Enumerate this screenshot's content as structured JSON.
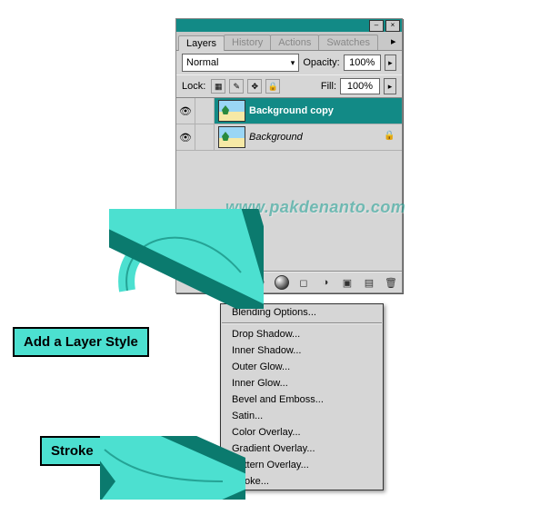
{
  "tabs": {
    "layers": "Layers",
    "history": "History",
    "actions": "Actions",
    "swatches": "Swatches"
  },
  "blend_row": {
    "mode": "Normal",
    "opacity_label": "Opacity:",
    "opacity_value": "100%"
  },
  "lock_row": {
    "label": "Lock:",
    "fill_label": "Fill:",
    "fill_value": "100%"
  },
  "layers": [
    {
      "name": "Background copy",
      "active": true,
      "locked": false
    },
    {
      "name": "Background",
      "active": false,
      "locked": true
    }
  ],
  "watermark": "www.pakdenanto.com",
  "menu": {
    "items": [
      "Blending Options...",
      "-",
      "Drop Shadow...",
      "Inner Shadow...",
      "Outer Glow...",
      "Inner Glow...",
      "Bevel and Emboss...",
      "Satin...",
      "Color Overlay...",
      "Gradient Overlay...",
      "Pattern Overlay...",
      "Stroke..."
    ]
  },
  "callouts": {
    "style": "Add a Layer Style",
    "stroke": "Stroke"
  },
  "titlebar": {
    "minimize": "–",
    "close": "×"
  },
  "icons": {
    "chevron_down": "▾",
    "menu_arrow": "▸",
    "eye": "👁",
    "lock_small": "🔒",
    "link": "⬭",
    "fx_circle": "◐",
    "mask": "◻",
    "adj": "◑",
    "folder": "▣",
    "new": "▤",
    "trash": "🗑",
    "transparent": "▦",
    "brush": "✎",
    "move": "✥"
  }
}
